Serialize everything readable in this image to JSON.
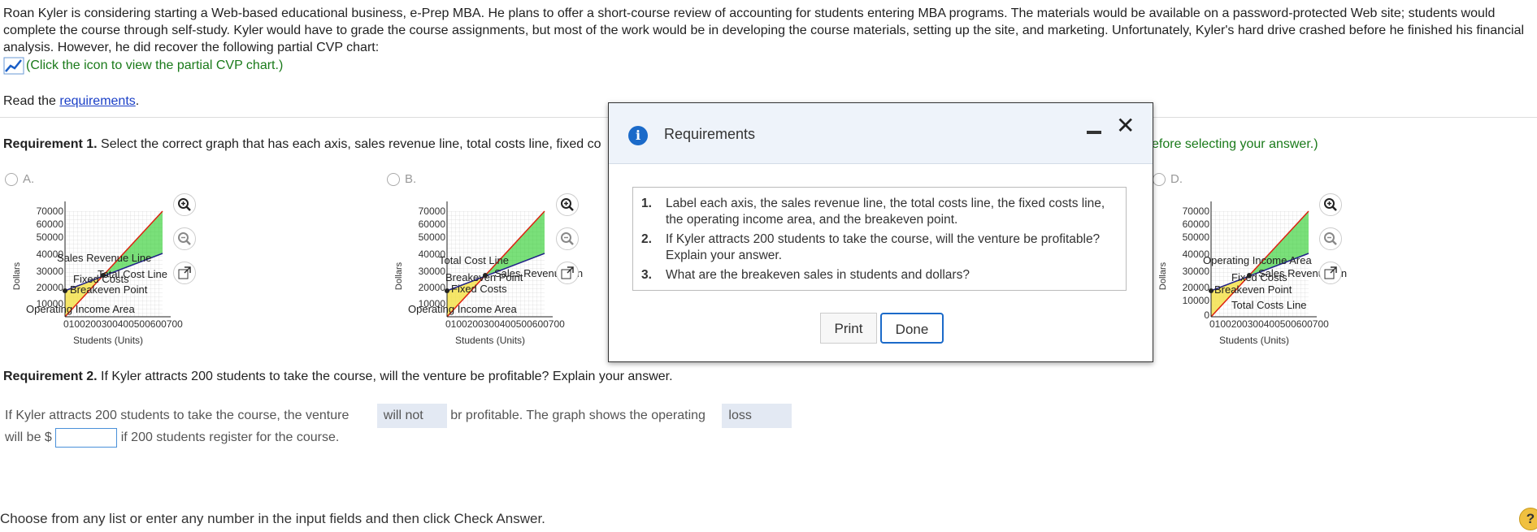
{
  "intro": "Roan Kyler is considering starting a Web-based educational business, e-Prep MBA. He plans to offer a short-course review of accounting for students entering MBA programs. The materials would be available on a password-protected Web site; students would complete the course through self-study. Kyler would have to grade the course assignments, but most of the work would be in developing the course materials, setting up the site, and marketing. Unfortunately, Kyler's hard drive crashed before he finished his financial analysis. However, he did recover the following partial CVP chart:",
  "chart_link": "(Click the icon to view the partial CVP chart.)",
  "read_prefix": "Read the ",
  "read_link": "requirements",
  "read_suffix": ".",
  "req1": {
    "label": "Requirement 1.",
    "text": " Select the correct graph that has each axis, sales revenue line, total costs line, fixed co",
    "tail": "efore selecting your answer.)"
  },
  "options": [
    {
      "letter": "A.",
      "yticks": [
        "70000",
        "60000",
        "50000",
        "40000",
        "30000",
        "20000",
        "10000",
        "0"
      ],
      "labels": [
        "Sales Revenue Line",
        "Fixed Costs",
        "Total Cost Line",
        "Breakeven Point",
        "Operating Income Area"
      ]
    },
    {
      "letter": "B.",
      "yticks": [
        "70000",
        "60000",
        "50000",
        "40000",
        "30000",
        "20000",
        "10000",
        "0"
      ],
      "labels": [
        "Total Cost Line",
        "Breakeven Point",
        "Sales Revenue Lin",
        "Fixed Costs",
        "Operating Income Area"
      ]
    },
    {
      "letter": "D.",
      "yticks": [
        "70000",
        "60000",
        "50000",
        "40000",
        "30000",
        "20000",
        "10000",
        "0"
      ],
      "labels": [
        "Operating Income Area",
        "Fixed Costs",
        "Sales Revenue Lin",
        "Breakeven Point",
        "Total Costs Line"
      ]
    }
  ],
  "x_ticks": "0100200300400500600700",
  "x_axis_label": "Students (Units)",
  "y_axis_label": "Dollars",
  "req2": {
    "label": "Requirement 2.",
    "text": " If Kyler attracts 200 students to take the course, will the venture be profitable? Explain your answer."
  },
  "answer": {
    "part1": "If Kyler attracts 200 students to take the course, the venture",
    "dd1": "will not",
    "part2": "br profitable. The graph shows the operating",
    "dd2": "loss",
    "part3": "will be $",
    "part4": "if 200 students register for the course."
  },
  "footer": "Choose from any list or enter any number in the input fields and then click Check Answer.",
  "help": "?",
  "modal": {
    "title": "Requirements",
    "items": [
      {
        "n": "1.",
        "text": "Label each axis, the sales revenue line, the total costs line, the fixed costs line, the operating income area, and the breakeven point."
      },
      {
        "n": "2.",
        "text": "If Kyler attracts 200 students to take the course, will the venture be profitable? Explain your answer."
      },
      {
        "n": "3.",
        "text": "What are the breakeven sales in students and dollars?"
      }
    ],
    "print": "Print",
    "done": "Done"
  }
}
